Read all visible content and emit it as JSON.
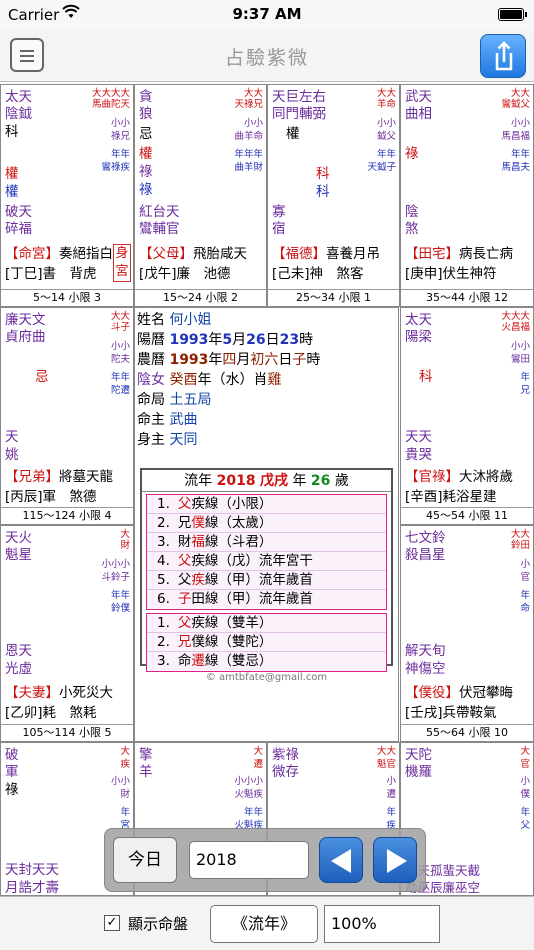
{
  "status": {
    "carrier": "Carrier",
    "time": "9:37 AM"
  },
  "nav": {
    "title": "占驗紫微"
  },
  "palaces": [
    {
      "id": "ming",
      "main": [
        "太天",
        "陰鉞"
      ],
      "sihua": "科",
      "extra": [
        [
          "權",
          "purple-red"
        ]
      ],
      "minor": [
        "權",
        "破天",
        "碎福"
      ],
      "side": [
        "大大大大",
        "馬曲陀天",
        "小小",
        "祿兄",
        "年年",
        "鸞祿疾"
      ],
      "name": "【命宮】",
      "branch": "[丁巳]",
      "gods": "奏絕指白",
      "gods2": "書　背虎",
      "body": "身宮",
      "range": "5～14 小限 3"
    },
    {
      "id": "fumu",
      "main": [
        "貪",
        "狼"
      ],
      "sihua": "忌",
      "extra": [
        [
          "權",
          "red"
        ],
        [
          "祿",
          "purple"
        ],
        [
          "祿",
          "blue"
        ]
      ],
      "minor": [
        "紅台天",
        "鸞輔官"
      ],
      "side": [
        "大大",
        "天祿兄",
        "小小",
        "曲羊命",
        "年年年",
        "曲羊財"
      ],
      "name": "【父母】",
      "branch": "[戊午]",
      "gods": "飛胎咸天",
      "gods2": "廉　池德",
      "range": "15～24 小限 2"
    },
    {
      "id": "fude",
      "main": [
        "天巨左右",
        "同門輔弼"
      ],
      "sihua": "權",
      "extra": [
        [
          "科",
          "red"
        ],
        [
          "科",
          "blue"
        ]
      ],
      "minor": [
        "寡",
        "宿"
      ],
      "side": [
        "大大",
        "羊命",
        "小小",
        "鉞父",
        "年年",
        "天鉞子"
      ],
      "name": "【福德】",
      "branch": "[己未]",
      "gods": "喜養月吊",
      "gods2": "神　煞客",
      "range": "25～34 小限 1"
    },
    {
      "id": "tianzhai",
      "main": [
        "武天",
        "曲相"
      ],
      "sihua": "",
      "extra": [
        [
          "祿",
          "red"
        ]
      ],
      "minor": [
        "陰",
        "煞"
      ],
      "side": [
        "大大",
        "鸞鉞父",
        "小小",
        "馬昌福",
        "年年",
        "馬昌夫"
      ],
      "name": "【田宅】",
      "branch": "[庚申]",
      "gods": "病長亡病",
      "gods2": "伏生神符",
      "range": "35～44 小限 12"
    },
    {
      "id": "xiongdi",
      "main": [
        "廉天文",
        "貞府曲"
      ],
      "sihua": "",
      "extra": [
        [
          "忌",
          "red"
        ]
      ],
      "minor": [
        "天",
        "姚"
      ],
      "side": [
        "大大",
        "斗子",
        "小小",
        "陀夫",
        "年年",
        "陀遷"
      ],
      "name": "【兄弟】",
      "branch": "[丙辰]",
      "gods": "將墓天龍",
      "gods2": "軍　煞德",
      "range": "115～124 小限 4"
    },
    {
      "id": "guanlu",
      "main": [
        "太天",
        "陽梁"
      ],
      "sihua": "",
      "extra": [
        [
          "科",
          "red"
        ]
      ],
      "minor": [
        "天天",
        "貴哭"
      ],
      "side": [
        "大大大",
        "火昌福",
        "小小",
        "鸞田",
        "年",
        "兄"
      ],
      "name": "【官祿】",
      "branch": "[辛酉]",
      "gods": "大沐將歲",
      "gods2": "耗浴星建",
      "range": "45～54 小限 11"
    },
    {
      "id": "fuqi",
      "main": [
        "天火",
        "魁星"
      ],
      "sihua": "",
      "extra": [],
      "minor": [
        "恩天",
        "光虛"
      ],
      "side": [
        "大",
        "財",
        "小小小",
        "斗鈴子",
        "年年",
        "鈴僕"
      ],
      "name": "【夫妻】",
      "branch": "[乙卯]",
      "gods": "小死災大",
      "gods2": "耗　煞耗",
      "range": "105～114 小限 5"
    },
    {
      "id": "puyi",
      "main": [
        "七文鈴",
        "殺昌星"
      ],
      "sihua": "",
      "extra": [],
      "minor": [
        "解天旬",
        "神傷空"
      ],
      "side": [
        "大大",
        "鈴田",
        "小",
        "官",
        "年",
        "命"
      ],
      "name": "【僕役】",
      "branch": "[壬戌]",
      "gods": "伏冠攀晦",
      "gods2": "兵帶鞍氣",
      "range": "55～64 小限 10"
    },
    {
      "id": "zinv",
      "main": [
        "破",
        "軍"
      ],
      "sihua": "祿",
      "extra": [],
      "minor": [
        "天封天天",
        "月誥才壽"
      ],
      "side": [
        "大",
        "疾",
        "小小",
        "財",
        "年",
        "宮"
      ],
      "name": "",
      "branch": "",
      "gods": "",
      "gods2": "",
      "range": ""
    },
    {
      "id": "caibo",
      "main": [
        "擎",
        "羊"
      ],
      "sihua": "",
      "extra": [],
      "minor": [],
      "side": [
        "大",
        "遷",
        "小小小",
        "火魁疾",
        "年年",
        "火魁疾"
      ],
      "name": "",
      "branch": "",
      "gods": "",
      "gods2": "",
      "range": ""
    },
    {
      "id": "jie",
      "main": [
        "紫祿",
        "微存"
      ],
      "sihua": "",
      "extra": [],
      "minor": [],
      "side": [
        "大大",
        "魁官",
        "小",
        "遷",
        "年",
        "疾"
      ],
      "name": "",
      "branch": "",
      "gods": "",
      "gods2": "",
      "range": ""
    },
    {
      "id": "qianyi",
      "main": [
        "天陀",
        "機羅"
      ],
      "sihua": "",
      "extra": [],
      "minor": [
        "地天孤蜚天截",
        "劫巫辰廉巫空"
      ],
      "side": [
        "大",
        "官",
        "小",
        "僕",
        "年",
        "父"
      ],
      "name": "",
      "branch": "",
      "gods": "",
      "gods2": "",
      "range": ""
    }
  ],
  "center": {
    "name_label": "姓名",
    "name": "何小姐",
    "solar_label": "陽曆",
    "solar_year": "1993",
    "solar_y": "年",
    "solar_month": "5",
    "solar_m": "月",
    "solar_day": "26",
    "solar_d": "日",
    "solar_hour": "23",
    "solar_h": "時",
    "lunar_label": "農曆",
    "lunar_year": "1993",
    "lunar_y": "年",
    "lunar_month": "四",
    "lunar_m": "月",
    "lunar_day": "初六",
    "lunar_d": "日",
    "lunar_hour": "子",
    "lunar_h": "時",
    "gender": "陰女",
    "stem": "癸酉",
    "stem_suffix": "年（水）肖",
    "zodiac": "雞",
    "ju_label": "命局",
    "ju": "土五局",
    "mingzhu_label": "命主",
    "mingzhu": "武曲",
    "shenzhu_label": "身主",
    "shenzhu": "天同",
    "flow_prefix": "流年",
    "flow_year": "2018",
    "flow_ganzhi": "戊戌",
    "flow_mid": "年",
    "flow_age": "26",
    "flow_suffix": "歲",
    "flow_rows1": [
      {
        "num": "1.",
        "pre": "",
        "hl": "父",
        "post": "疾線（小限）"
      },
      {
        "num": "2.",
        "pre": "兄",
        "hl": "僕",
        "post": "線（太歲）"
      },
      {
        "num": "3.",
        "pre": "財",
        "hl": "福",
        "post": "線（斗君）"
      },
      {
        "num": "4.",
        "pre": "",
        "hl": "父",
        "post": "疾線（戊）流年宮干"
      },
      {
        "num": "5.",
        "pre": "父",
        "hl": "疾",
        "post": "線（甲）流年歲首"
      },
      {
        "num": "6.",
        "pre": "",
        "hl": "子",
        "post": "田線（甲）流年歲首"
      }
    ],
    "flow_rows2": [
      {
        "num": "1.",
        "pre": "",
        "hl": "父",
        "post": "疾線（雙羊）"
      },
      {
        "num": "2.",
        "pre": "",
        "hl": "兄",
        "post": "僕線（雙陀）"
      },
      {
        "num": "3.",
        "pre": "命",
        "hl": "遷",
        "post": "線（雙忌）"
      }
    ],
    "copyright": "© amtbfate@gmail.com"
  },
  "control": {
    "today": "今日",
    "year": "2018"
  },
  "toolbar": {
    "check": "✓",
    "show_chart": "顯示命盤",
    "flow_button": "《流年》",
    "zoom": "100%"
  }
}
